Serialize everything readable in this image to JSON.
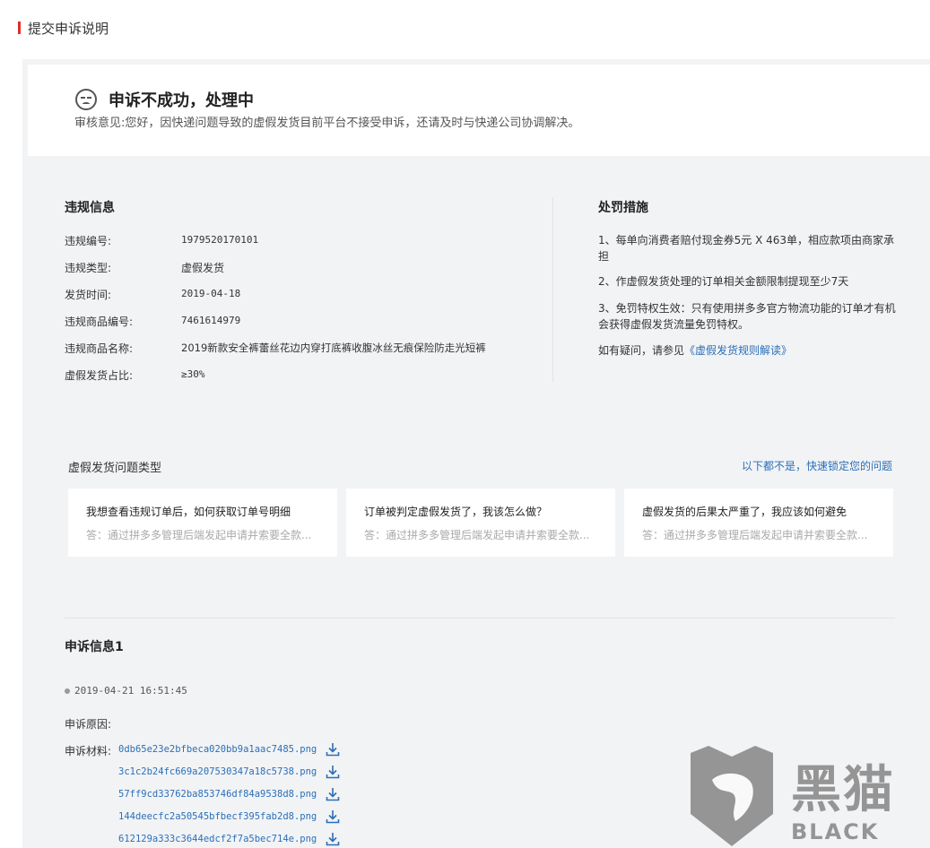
{
  "header": {
    "title": "提交申诉说明"
  },
  "status": {
    "title": "申诉不成功，处理中",
    "description": "审核意见:您好，因快递问题导致的虚假发货目前平台不接受申诉，还请及时与快递公司协调解决。"
  },
  "violation": {
    "title": "违规信息",
    "rows": [
      {
        "label": "违规编号:",
        "value": "1979520170101"
      },
      {
        "label": "违规类型:",
        "value": "虚假发货"
      },
      {
        "label": "发货时间:",
        "value": "2019-04-18"
      },
      {
        "label": "违规商品编号:",
        "value": "7461614979"
      },
      {
        "label": "违规商品名称:",
        "value": "2019新款安全裤蕾丝花边内穿打底裤收腹冰丝无痕保险防走光短裤"
      },
      {
        "label": "虚假发货占比:",
        "value": "≥30%"
      }
    ]
  },
  "penalty": {
    "title": "处罚措施",
    "items": [
      "1、每单向消费者赔付现金券5元 X 463单，相应款项由商家承担",
      "2、作虚假发货处理的订单相关金额限制提现至少7天",
      "3、免罚特权生效：只有使用拼多多官方物流功能的订单才有机会获得虚假发货流量免罚特权。"
    ],
    "help_prefix": "如有疑问，请参见",
    "help_link": "《虚假发货规则解读》"
  },
  "faq": {
    "title": "虚假发货问题类型",
    "link": "以下都不是，快速锁定您的问题",
    "cards": [
      {
        "q": "我想查看违规订单后，如何获取订单号明细",
        "a": "答：通过拼多多管理后端发起申请并索要全款..."
      },
      {
        "q": "订单被判定虚假发货了，我该怎么做？",
        "a": "答：通过拼多多管理后端发起申请并索要全款..."
      },
      {
        "q": "虚假发货的后果太严重了，我应该如何避免",
        "a": "答：通过拼多多管理后端发起申请并索要全款..."
      }
    ]
  },
  "appeal": {
    "title": "申诉信息1",
    "time": "2019-04-21 16:51:45",
    "reason_label": "申诉原因:",
    "materials_label": "申诉材料:",
    "files": [
      "0db65e23e2bfbeca020bb9a1aac7485.png",
      "3c1c2b24fc669a207530347a18c5738.png",
      "57ff9cd33762ba853746df84a9538d8.png",
      "144deecfc2a50545bfbecf395fab2d8.png",
      "612129a333c3644edcf2f7a5bec714e.png"
    ]
  },
  "watermark": {
    "cn": "黑猫",
    "en": "BLACK CAT"
  },
  "colors": {
    "accent": "#e02e24",
    "link": "#2a6fb8",
    "panel": "#f2f3f5"
  },
  "icons": {
    "status": "sad-face-icon",
    "download": "download-icon"
  }
}
